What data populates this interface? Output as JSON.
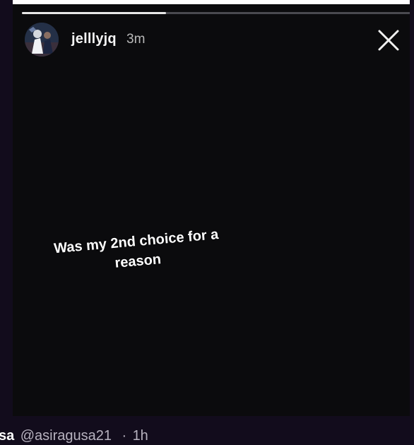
{
  "story": {
    "progress": 0.37,
    "username": "jelllyjq",
    "time_ago": "3m",
    "text": "Was my 2nd choice for a reason",
    "close_icon": "close-icon",
    "avatar_icon": "avatar"
  },
  "tweet": {
    "display_name_fragment": "sa",
    "handle": "@asiragusa21",
    "separator": "·",
    "time": "1h"
  },
  "colors": {
    "story_background": "#0b0b0d",
    "page_background": "#120c1c",
    "text_primary": "#ffffff",
    "text_secondary": "#b9b9b9"
  }
}
